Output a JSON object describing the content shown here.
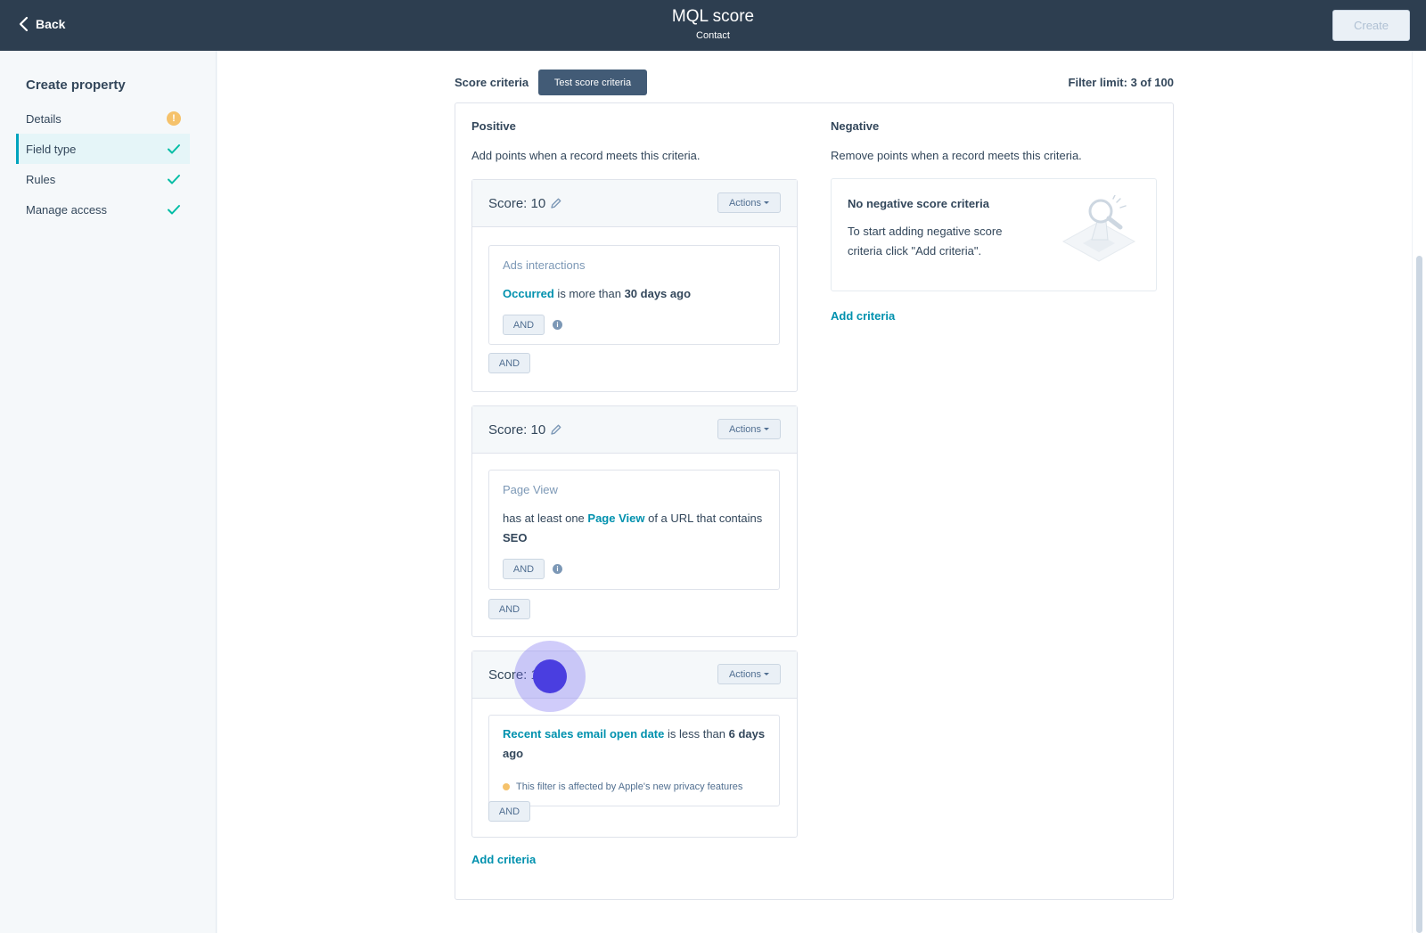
{
  "topbar": {
    "back_label": "Back",
    "title": "MQL score",
    "subtitle": "Contact",
    "create_label": "Create"
  },
  "sidebar": {
    "title": "Create property",
    "items": [
      {
        "label": "Details",
        "status": "warning",
        "status_glyph": "!"
      },
      {
        "label": "Field type",
        "status": "complete",
        "active": true
      },
      {
        "label": "Rules",
        "status": "complete"
      },
      {
        "label": "Manage access",
        "status": "complete"
      }
    ]
  },
  "main": {
    "score_criteria_label": "Score criteria",
    "test_button_label": "Test score criteria",
    "filter_limit": "Filter limit: 3 of 100",
    "positive": {
      "title": "Positive",
      "description": "Add points when a record meets this criteria.",
      "add_criteria_label": "Add criteria",
      "groups": [
        {
          "score_label": "Score: 10",
          "actions_label": "Actions",
          "criterion": {
            "type": "Ads interactions",
            "link": "Occurred",
            "middle": " is more than ",
            "bold": "30 days ago"
          },
          "inner_and_label": "AND",
          "outer_and_label": "AND"
        },
        {
          "score_label": "Score: 10",
          "actions_label": "Actions",
          "criterion": {
            "type": "Page View",
            "prefix": "has at least one ",
            "link": "Page View",
            "middle": " of a URL that contains ",
            "bold": "SEO"
          },
          "inner_and_label": "AND",
          "outer_and_label": "AND"
        },
        {
          "score_label": "Score: 1",
          "actions_label": "Actions",
          "criterion": {
            "link": "Recent sales email open date",
            "middle": " is less than ",
            "bold": "6 days ago",
            "note": "This filter is affected by Apple's new privacy features"
          },
          "outer_and_label": "AND"
        }
      ]
    },
    "negative": {
      "title": "Negative",
      "description": "Remove points when a record meets this criteria.",
      "empty_title": "No negative score criteria",
      "empty_text": "To start adding negative score criteria click \"Add criteria\".",
      "add_criteria_label": "Add criteria"
    },
    "info_glyph": "i"
  },
  "colors": {
    "topbar": "#2d3e50",
    "accent": "#00a4bd",
    "link": "#0091ae",
    "success": "#00bda5",
    "warning": "#f5c26b",
    "cursor": "#4a3ee0"
  }
}
